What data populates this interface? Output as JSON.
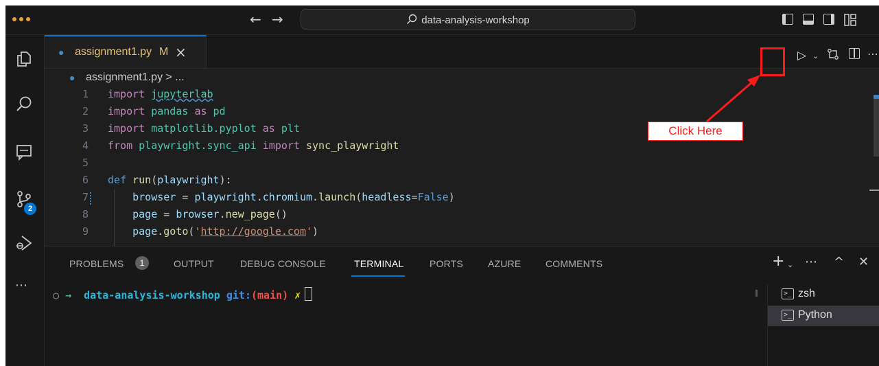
{
  "titlebar": {
    "back_icon": "arrow-left-icon",
    "forward_icon": "arrow-right-icon",
    "search_text": "data-analysis-workshop"
  },
  "activity_bar": {
    "items": [
      "explorer-icon",
      "search-icon",
      "remote-explorer-icon",
      "source-control-icon",
      "run-debug-icon",
      "more-icon"
    ],
    "source_control_badge": "2"
  },
  "editor": {
    "tab": {
      "filename": "assignment1.py",
      "status": "M",
      "close": "×"
    },
    "breadcrumb": "assignment1.py > ...",
    "lines": [
      {
        "num": "1"
      },
      {
        "num": "2"
      },
      {
        "num": "3"
      },
      {
        "num": "4"
      },
      {
        "num": "5"
      },
      {
        "num": "6"
      },
      {
        "num": "7"
      },
      {
        "num": "8"
      },
      {
        "num": "9"
      }
    ]
  },
  "panel": {
    "tabs": [
      "PROBLEMS",
      "OUTPUT",
      "DEBUG CONSOLE",
      "TERMINAL",
      "PORTS",
      "AZURE",
      "COMMENTS"
    ],
    "active_tab": "TERMINAL",
    "problems_count": "1",
    "terminal": {
      "prompt_dir": "data-analysis-workshop",
      "git_label": "git:",
      "branch": "(main)",
      "dirty_mark": "✗"
    },
    "terminal_list": [
      "zsh",
      "Python"
    ],
    "selected_terminal": "Python"
  },
  "annotation": {
    "label": "Click Here",
    "color": "#ff1a1a"
  },
  "colors": {
    "accent": "#0078d4",
    "editor_bg": "#1e1e1e",
    "sidebar_bg": "#181818"
  }
}
